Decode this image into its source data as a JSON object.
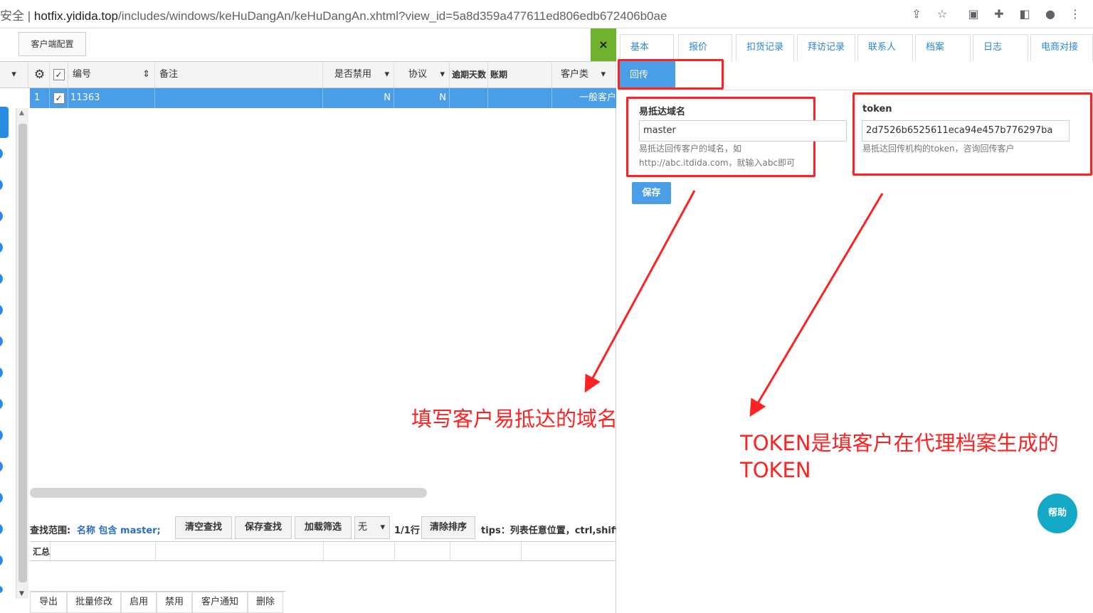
{
  "browser": {
    "security_fragment": "安全",
    "url_host": "hotfix.yidida.top",
    "url_path": "/includes/windows/keHuDangAn/keHuDangAn.xhtml?view_id=5a8d359a477611ed806edb672406b0ae"
  },
  "left_panel": {
    "config_button": "客户端配置",
    "close_label": "×",
    "columns": [
      "编号",
      "备注",
      "是否禁用",
      "协议",
      "逾期天数",
      "账期",
      "客户类"
    ],
    "row": {
      "index": "1",
      "code": "11363",
      "disabled": "N",
      "protocol": "N",
      "customer_type": "一般客户"
    },
    "search_scope_label": "查找范围:",
    "search_scope_value": "名称 包含 master;",
    "toolbar": {
      "clear_search": "清空查找",
      "save_search": "保存查找",
      "load_filter": "加载筛选",
      "filter_select": "无",
      "page_info": "1/1行",
      "clear_sort": "清除排序",
      "tips": "tips：列表任意位置，ctrl,shift"
    },
    "summary_label": "汇总",
    "bottom_actions": [
      "导出",
      "批量修改",
      "启用",
      "禁用",
      "客户通知",
      "删除"
    ]
  },
  "right_panel": {
    "tabs": [
      "基本",
      "报价",
      "扣货记录",
      "拜访记录",
      "联系人",
      "档案",
      "日志",
      "电商对接"
    ],
    "active_tab": "回传",
    "domain_field": {
      "label": "易抵达域名",
      "value": "master",
      "help": "易抵达回传客户的域名，如http://abc.itdida.com，就输入abc即可"
    },
    "token_field": {
      "label": "token",
      "value": "2d7526b6525611eca94e457b776297ba",
      "help": "易抵达回传机构的token，咨询回传客户"
    },
    "save_button": "保存",
    "help_button": "帮助"
  },
  "annotations": {
    "domain_note": "填写客户易抵达的域名",
    "token_note": "TOKEN是填客户在代理档案生成的TOKEN"
  },
  "colors": {
    "accent_blue": "#4a9de7",
    "annotation_red": "#ff2222",
    "close_green": "#6fb22d",
    "help_teal": "#14a9c7"
  }
}
